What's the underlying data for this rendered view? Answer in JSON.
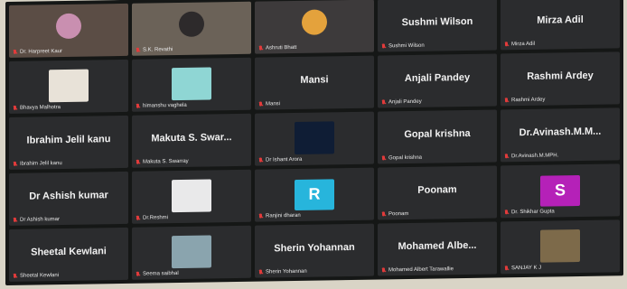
{
  "participants": [
    {
      "name": "Dr. Harpreet Kaur",
      "big": "",
      "kind": "video",
      "bg": "#5b4d45",
      "accent": "#c98fb0"
    },
    {
      "name": "S.K. Revathi",
      "big": "",
      "kind": "video",
      "bg": "#6b6258",
      "accent": "#2d2a2b"
    },
    {
      "name": "Ashruti Bhatt",
      "big": "",
      "kind": "video",
      "bg": "#3d3a3b",
      "accent": "#e4a23c"
    },
    {
      "name": "Sushmi Wilson",
      "big": "Sushmi Wilson",
      "kind": "name"
    },
    {
      "name": "Mirza Adil",
      "big": "Mirza Adil",
      "kind": "name"
    },
    {
      "name": "Bhavya Malhotra",
      "big": "",
      "kind": "photo",
      "thumb": "#e8e2d8"
    },
    {
      "name": "himanshu vaghela",
      "big": "",
      "kind": "photo",
      "thumb": "#8fd6d4"
    },
    {
      "name": "Mansi",
      "big": "Mansi",
      "kind": "name"
    },
    {
      "name": "Anjali Pandey",
      "big": "Anjali Pandey",
      "kind": "name"
    },
    {
      "name": "Rashmi Ardey",
      "big": "Rashmi Ardey",
      "kind": "name"
    },
    {
      "name": "Ibrahim Jelil kanu",
      "big": "Ibrahim Jelil kanu",
      "kind": "name"
    },
    {
      "name": "Makuta S. Swarray",
      "big": "Makuta S. Swar...",
      "kind": "name"
    },
    {
      "name": "Dr Ishant Arora",
      "big": "",
      "kind": "photo",
      "thumb": "#0f1d35"
    },
    {
      "name": "Gopal krishna",
      "big": "Gopal krishna",
      "kind": "name"
    },
    {
      "name": "Dr.Avinash.M.MPH.",
      "big": "Dr.Avinash.M.M...",
      "kind": "name"
    },
    {
      "name": "Dr Ashish kumar",
      "big": "Dr Ashish kumar",
      "kind": "name"
    },
    {
      "name": "Dr.Reshmi",
      "big": "",
      "kind": "photo",
      "thumb": "#e9e9ea"
    },
    {
      "name": "Ranjini dharan",
      "big": "",
      "kind": "letter",
      "letter": "R",
      "color": "#27b5dc"
    },
    {
      "name": "Poonam",
      "big": "Poonam",
      "kind": "name"
    },
    {
      "name": "Dr. Shikhar Gupta",
      "big": "",
      "kind": "letter",
      "letter": "S",
      "color": "#b521b8"
    },
    {
      "name": "Sheetal Kewlani",
      "big": "Sheetal Kewlani",
      "kind": "name"
    },
    {
      "name": "Seema saibhal",
      "big": "",
      "kind": "photo",
      "thumb": "#8aa4ae"
    },
    {
      "name": "Sherin Yohannan",
      "big": "Sherin Yohannan",
      "kind": "name"
    },
    {
      "name": "Mohamed Albert Tarawallie",
      "big": "Mohamed Albe...",
      "kind": "name"
    },
    {
      "name": "SANJAY K J",
      "big": "",
      "kind": "photo",
      "thumb": "#7d6a4a"
    }
  ]
}
